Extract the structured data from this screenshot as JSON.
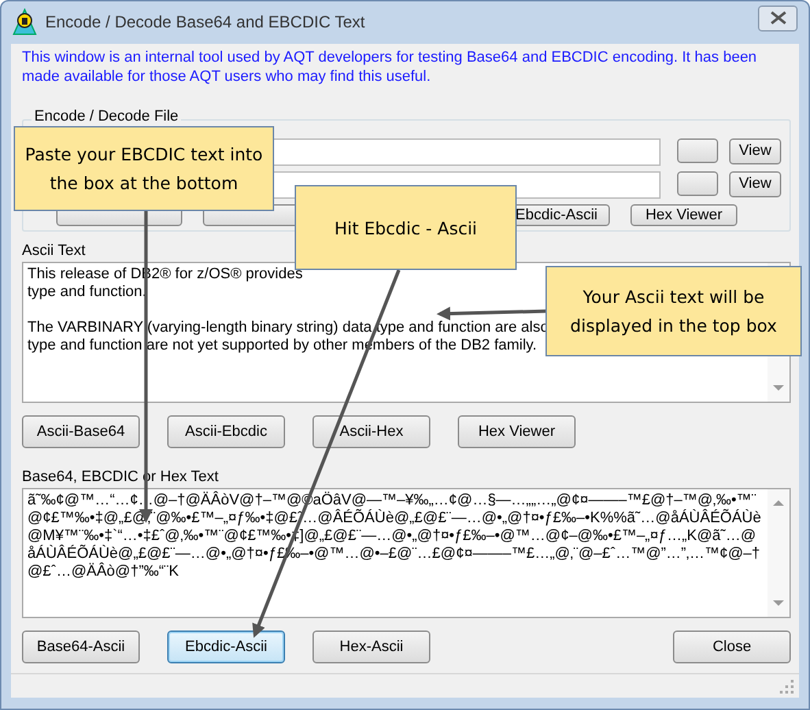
{
  "window": {
    "title": "Encode / Decode Base64 and EBCDIC Text"
  },
  "intro": "This window is an internal tool used by AQT developers for testing Base64 and EBCDIC encoding. It has been made available for those AQT users who may find this useful.",
  "file_group": {
    "label": "Encode / Decode File",
    "rows": [
      {
        "view_button": "View"
      },
      {
        "view_button": "View"
      }
    ],
    "buttons": [
      {
        "label": "Ebcdic-Ascii"
      },
      {
        "label": "Hex Viewer"
      }
    ]
  },
  "ascii_section": {
    "label": "Ascii Text",
    "paragraphs": [
      [
        "This release of DB2® for z/OS® provides",
        "type and function."
      ],
      [
        "The VARBINARY (varying-length binary string) data type and function are also",
        "type and function are not yet supported by other members of the DB2 family."
      ]
    ],
    "buttons": [
      {
        "label": "Ascii-Base64",
        "focused": false
      },
      {
        "label": "Ascii-Ebcdic",
        "focused": false
      },
      {
        "label": "Ascii-Hex",
        "focused": false
      },
      {
        "label": "Hex Viewer",
        "focused": false
      }
    ]
  },
  "encoded_section": {
    "label": "Base64, EBCDIC or Hex Text",
    "text": "ã˜‰¢@™…“…¢…@–†@ÄÂòV@†–™@©aÖâV@—™–¥‰„…¢@…§—…„„…„@¢¤——–™£@†–™@‚‰•™¨@¢£™‰•‡@„£@‚¨@‰•£™–„¤ƒ‰•‡@£ˆ…@ÂÉÕÁÙè@„£@£¨—…@•„@†¤•ƒ£‰–•K%%ã˜…@åÁÙÂÉÕÁÙè@M¥™¨‰•‡`“…•‡£ˆ@‚‰•™¨@¢£™‰•‡]@„£@£¨—…@•„@†¤•ƒ£‰–•@™…@¢–@‰•£™–„¤ƒ…„K@ã˜…@åÁÙÂÉÕÁÙè@„£@£¨—…@•„@†¤•ƒ£‰–•@™…@•–£@¨…£@¢¤——–™£…„@‚¨@–£ˆ…™@”…”‚…™¢@–†@£ˆ…@ÄÂò@†”‰“¨K",
    "buttons": [
      {
        "label": "Base64-Ascii",
        "focused": false
      },
      {
        "label": "Ebcdic-Ascii",
        "focused": true
      },
      {
        "label": "Hex-Ascii",
        "focused": false
      }
    ],
    "close_button": "Close"
  },
  "callouts": [
    {
      "text": "Paste your EBCDIC text into the box at the bottom"
    },
    {
      "text": "Hit Ebcdic - Ascii"
    },
    {
      "text": "Your Ascii text will be displayed in the top box"
    }
  ]
}
